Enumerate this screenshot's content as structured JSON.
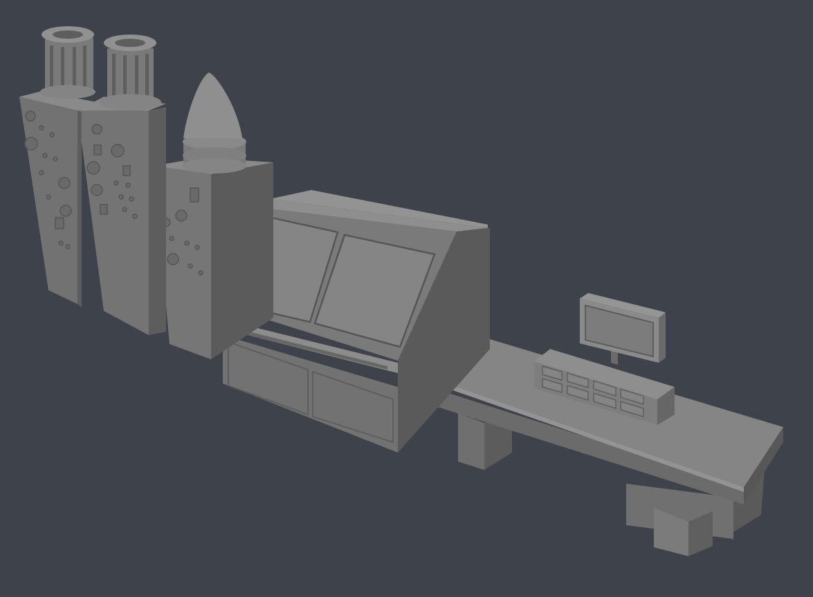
{
  "scene": {
    "background": "#3d424b",
    "model_color": "#808080",
    "objects": [
      "left-cabinet-with-vent-stack",
      "middle-cabinet-with-vent-stack",
      "right-cabinet-with-cone",
      "control-console-with-twin-screens",
      "desk-with-monitor-and-keypad"
    ]
  }
}
